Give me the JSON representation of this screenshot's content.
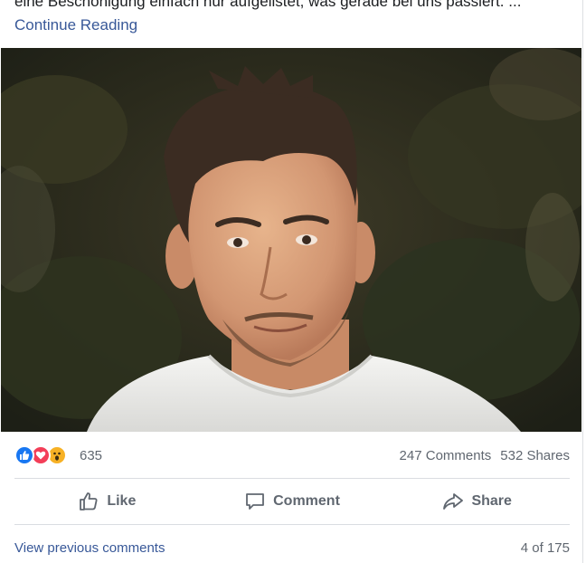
{
  "post": {
    "text": "eine Beschönigung einfach nur aufgelistet, was gerade bei uns passiert. ...",
    "continue_label": "Continue Reading"
  },
  "reactions": {
    "icons": [
      "like-icon",
      "love-icon",
      "wow-icon"
    ],
    "colors": {
      "like": "#1877f2",
      "love": "#f33e58",
      "wow": "#f7b125"
    },
    "count": "635"
  },
  "stats": {
    "comments": "247 Comments",
    "shares": "532 Shares"
  },
  "actions": {
    "like_label": "Like",
    "comment_label": "Comment",
    "share_label": "Share"
  },
  "comments_footer": {
    "view_previous_label": "View previous comments",
    "page_count": "4 of 175"
  }
}
